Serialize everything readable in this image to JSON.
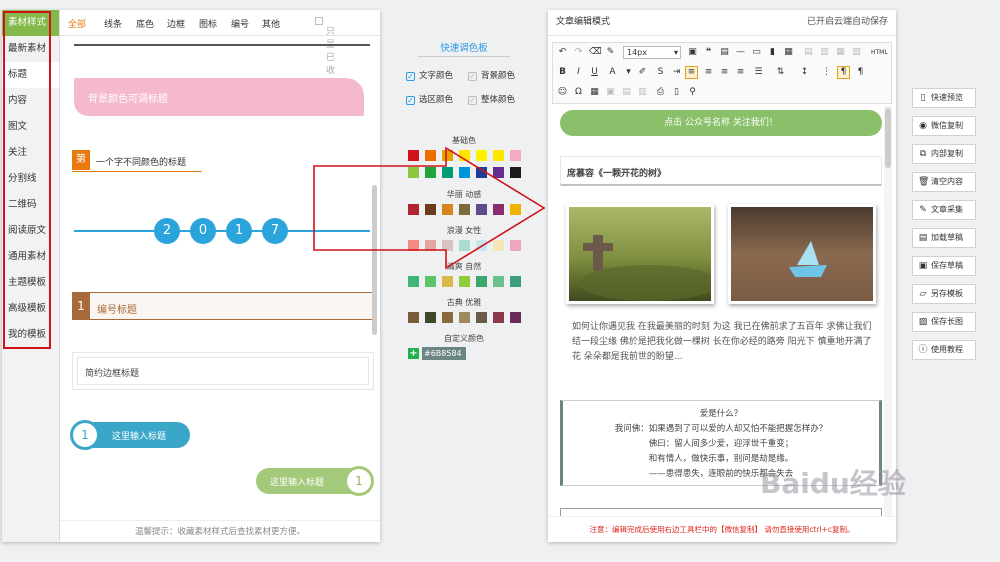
{
  "left_panel": {
    "sidebar": [
      {
        "label": "素材样式"
      },
      {
        "label": "最新素材"
      },
      {
        "label": "标题"
      },
      {
        "label": "内容"
      },
      {
        "label": "图文"
      },
      {
        "label": "关注"
      },
      {
        "label": "分割线"
      },
      {
        "label": "二维码"
      },
      {
        "label": "阅读原文"
      },
      {
        "label": "通用素材"
      },
      {
        "label": "主题模板"
      },
      {
        "label": "高级模板"
      },
      {
        "label": "我的模板"
      }
    ],
    "tabs": [
      {
        "label": "全部"
      },
      {
        "label": "线条"
      },
      {
        "label": "底色"
      },
      {
        "label": "边框"
      },
      {
        "label": "图标"
      },
      {
        "label": "编号"
      },
      {
        "label": "其他"
      }
    ],
    "only_favorites_label": "只显已收藏",
    "samples": {
      "bg_title": "背景颜色可调标题",
      "word_badge": "第",
      "word_title": "一个字不同颜色的标题",
      "year_digits": [
        "2",
        "0",
        "1",
        "7"
      ],
      "number_badge": "1",
      "number_title": "编号标题",
      "simple_border": "简约边框标题",
      "circle_left_num": "1",
      "circle_left_text": "这里输入标题",
      "circle_right_num": "1",
      "circle_right_text": "这里输入标题"
    },
    "tip": "温馨提示：收藏素材样式后查找素材更方便。"
  },
  "palette": {
    "title": "快速调色板",
    "options": [
      {
        "label": "文字颜色",
        "checked": true
      },
      {
        "label": "背景颜色",
        "checked": false
      },
      {
        "label": "选区颜色",
        "checked": true
      },
      {
        "label": "整体颜色",
        "checked": false
      }
    ],
    "groups": [
      {
        "name": "基础色",
        "colors": [
          "#d0121a",
          "#ec6c00",
          "#e8a200",
          "#ffe400",
          "#fff200",
          "#ffe600",
          "#f4a9c4",
          "#8dc63f",
          "#1ea63c",
          "#009b77",
          "#0094d9",
          "#1c3f95",
          "#662d91",
          "#1a1a1a"
        ]
      },
      {
        "name": "华丽 动感",
        "colors": [
          "#b22432",
          "#6f3a1b",
          "#d7861d",
          "#7d6b3b",
          "#5c4a8c",
          "#8b2c6e",
          "#f0b400"
        ]
      },
      {
        "name": "浪漫 女性",
        "colors": [
          "#f28b82",
          "#e6a5a5",
          "#d8c3c3",
          "#a8dcd1",
          "#c9e6f0",
          "#f4e6b8",
          "#f0a5bf"
        ]
      },
      {
        "name": "清爽 自然",
        "colors": [
          "#3fb57a",
          "#5cc56a",
          "#d8b84a",
          "#8fcc3a",
          "#3aa86a",
          "#6ac28a",
          "#3c9c7c"
        ]
      },
      {
        "name": "古典 优雅",
        "colors": [
          "#7a5c3a",
          "#3d4a2a",
          "#8a6a3a",
          "#a08a5a",
          "#6a5a4a",
          "#8a3a4a",
          "#6a2a5a"
        ]
      }
    ],
    "custom_label": "自定义颜色",
    "custom_value": "#6B8584"
  },
  "editor": {
    "title": "文章编辑模式",
    "autosave": "已开启云端自动保存",
    "font_size": "14px",
    "follow_button": "点击 公众号名称 关注我们！",
    "article_title": "席慕容《一颗开花的树》",
    "paragraph": "如何让你遇见我 在我最美丽的时刻 为这 我已在佛前求了五百年 求佛让我们结一段尘缘 佛於是把我化做一棵树 长在你必经的路旁 阳光下 慎重地开满了花 朵朵都是我前世的盼望...",
    "quote_lines": [
      "爱是什么？",
      "我问佛：如果遇到了可以爱的人却又怕不能把握怎样办？",
      "佛曰：留人间多少爱，迎浮世千重变；",
      "和有情人，做快乐事，别问是劫是缘。",
      "——患得患失，连眼前的快乐都会失去"
    ],
    "bottom_notice": "注意：编辑完成后使用右边工具栏中的【微信复制】 请勿直接使用ctrl+c复制。"
  },
  "actions": [
    {
      "label": "快速预览",
      "icon": "phone-icon"
    },
    {
      "label": "微信复制",
      "icon": "wechat-icon"
    },
    {
      "label": "内部复制",
      "icon": "copy-icon"
    },
    {
      "label": "清空内容",
      "icon": "trash-icon"
    },
    {
      "label": "文章采集",
      "icon": "edit-icon"
    },
    {
      "label": "加载草稿",
      "icon": "load-icon"
    },
    {
      "label": "保存草稿",
      "icon": "save-icon"
    },
    {
      "label": "另存模板",
      "icon": "folder-icon"
    },
    {
      "label": "保存长图",
      "icon": "image-icon"
    },
    {
      "label": "使用教程",
      "icon": "info-icon"
    }
  ],
  "watermark": "Baidu经验"
}
